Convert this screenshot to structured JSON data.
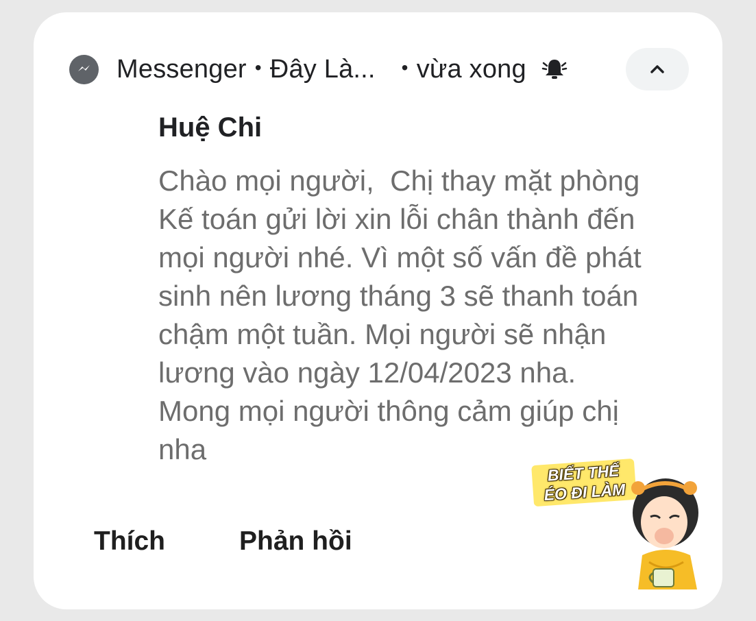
{
  "notification": {
    "app_name": "Messenger",
    "conversation": "Đây Là...",
    "time": "vừa xong",
    "separator": "•",
    "sender": "Huệ Chi",
    "message": "Chào mọi người,  Chị thay mặt phòng\nKế toán gửi lời xin lỗi chân thành đến\nmọi người nhé. Vì một số vấn đề phát\nsinh nên lương tháng 3 sẽ thanh toán\nchậm một tuần. Mọi người sẽ nhận\nlương vào ngày 12/04/2023 nha.\nMong mọi người thông cảm giúp chị\nnha",
    "icons": {
      "app": "messenger-icon",
      "bell": "bell-icon",
      "collapse": "chevron-up-icon"
    }
  },
  "actions": {
    "like_label": "Thích",
    "reply_label": "Phản hồi"
  },
  "sticker": {
    "caption_line1": "BIẾT THẾ",
    "caption_line2": "ÉO ĐI LÀM"
  }
}
